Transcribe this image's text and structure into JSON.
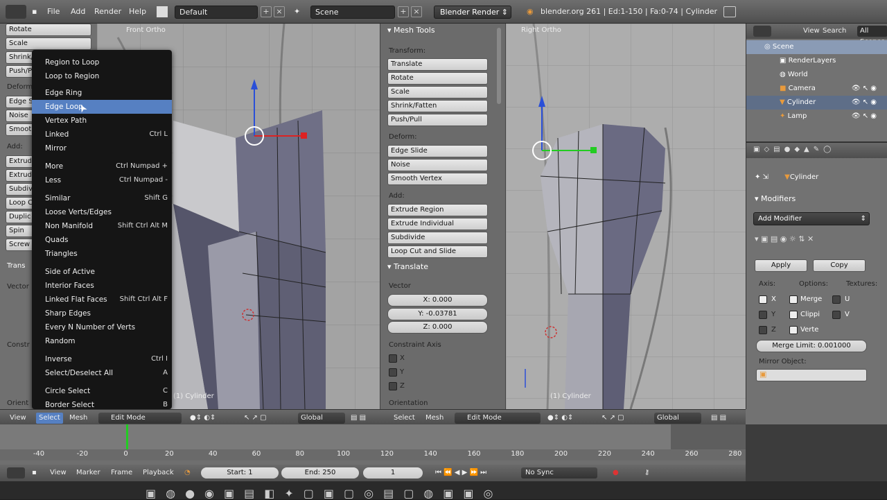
{
  "topbar": {
    "menus": [
      "File",
      "Add",
      "Render",
      "Help"
    ],
    "screen_layout": "Default",
    "scene": "Scene",
    "render_engine": "Blender Render",
    "stats": "blender.org 261 | Ed:1-150 | Fa:0-74 | Cylinder"
  },
  "toolshelf": {
    "buttons": [
      "Rotate",
      "Scale",
      "Shrink/",
      "Push/P",
      "Deform",
      "Edge S",
      "Noise",
      "Smoot",
      "Add:",
      "Extrud",
      "Extrud",
      "Subdiv",
      "Loop C",
      "Duplic",
      "Spin",
      "Screw",
      "Trans",
      "Vector",
      "Constr",
      "Orient"
    ]
  },
  "viewport_left": {
    "label": "Front Ortho",
    "object_label": "(1) Cylinder"
  },
  "viewport_right": {
    "label": "Right Ortho",
    "object_label": "(1) Cylinder"
  },
  "menu": {
    "items": [
      {
        "label": "Region to Loop",
        "shortcut": ""
      },
      {
        "label": "Loop to Region",
        "shortcut": ""
      },
      {
        "label": "Edge Ring",
        "shortcut": ""
      },
      {
        "label": "Edge Loop",
        "shortcut": ""
      },
      {
        "label": "Vertex Path",
        "shortcut": ""
      },
      {
        "label": "Linked",
        "shortcut": "Ctrl L"
      },
      {
        "label": "Mirror",
        "shortcut": ""
      },
      {
        "label": "More",
        "shortcut": "Ctrl Numpad +"
      },
      {
        "label": "Less",
        "shortcut": "Ctrl Numpad -"
      },
      {
        "label": "Similar",
        "shortcut": "Shift G"
      },
      {
        "label": "Loose Verts/Edges",
        "shortcut": ""
      },
      {
        "label": "Non Manifold",
        "shortcut": "Shift Ctrl Alt M"
      },
      {
        "label": "Quads",
        "shortcut": ""
      },
      {
        "label": "Triangles",
        "shortcut": ""
      },
      {
        "label": "Side of Active",
        "shortcut": ""
      },
      {
        "label": "Interior Faces",
        "shortcut": ""
      },
      {
        "label": "Linked Flat Faces",
        "shortcut": "Shift Ctrl Alt F"
      },
      {
        "label": "Sharp Edges",
        "shortcut": ""
      },
      {
        "label": "Every N Number of Verts",
        "shortcut": ""
      },
      {
        "label": "Random",
        "shortcut": ""
      },
      {
        "label": "Inverse",
        "shortcut": "Ctrl I"
      },
      {
        "label": "Select/Deselect All",
        "shortcut": "A"
      },
      {
        "label": "Circle Select",
        "shortcut": "C"
      },
      {
        "label": "Border Select",
        "shortcut": "B"
      }
    ]
  },
  "meshtools": {
    "title": "Mesh Tools",
    "transform_label": "Transform:",
    "transform": [
      "Translate",
      "Rotate",
      "Scale",
      "Shrink/Fatten",
      "Push/Pull"
    ],
    "deform_label": "Deform:",
    "deform": [
      "Edge Slide",
      "Noise",
      "Smooth Vertex"
    ],
    "add_label": "Add:",
    "add": [
      "Extrude Region",
      "Extrude Individual",
      "Subdivide",
      "Loop Cut and Slide"
    ],
    "translate_title": "Translate",
    "vector_label": "Vector",
    "vector": [
      "X: 0.000",
      "Y: -0.03781",
      "Z: 0.000"
    ],
    "constraint_label": "Constraint Axis",
    "axes": [
      "X",
      "Y",
      "Z"
    ],
    "orientation_label": "Orientation"
  },
  "outliner": {
    "menus": [
      "View",
      "Search",
      "All Scenes"
    ],
    "items": [
      "Scene",
      "RenderLayers",
      "World",
      "Camera",
      "Cylinder",
      "Lamp"
    ]
  },
  "properties": {
    "object": "Cylinder",
    "modifiers_title": "Modifiers",
    "add_modifier": "Add Modifier",
    "apply": "Apply",
    "copy": "Copy",
    "axis_label": "Axis:",
    "options_label": "Options:",
    "textures_label": "Textures:",
    "axes": [
      "X",
      "Y",
      "Z"
    ],
    "options": [
      "Merge",
      "Clippi",
      "Verte"
    ],
    "textures": [
      "U",
      "V"
    ],
    "merge_limit": "Merge Limit: 0.001000",
    "mirror_object": "Mirror Object:"
  },
  "view_header": {
    "menus": [
      "View",
      "Select",
      "Mesh"
    ],
    "mode": "Edit Mode",
    "orientation": "Global"
  },
  "timeline": {
    "ticks": [
      "-40",
      "-20",
      "0",
      "20",
      "40",
      "60",
      "80",
      "100",
      "120",
      "140",
      "160",
      "180",
      "200",
      "220",
      "240",
      "260",
      "280"
    ],
    "menus": [
      "View",
      "Marker",
      "Frame",
      "Playback"
    ],
    "start": "Start: 1",
    "end": "End: 250",
    "current": "1",
    "sync": "No Sync"
  }
}
